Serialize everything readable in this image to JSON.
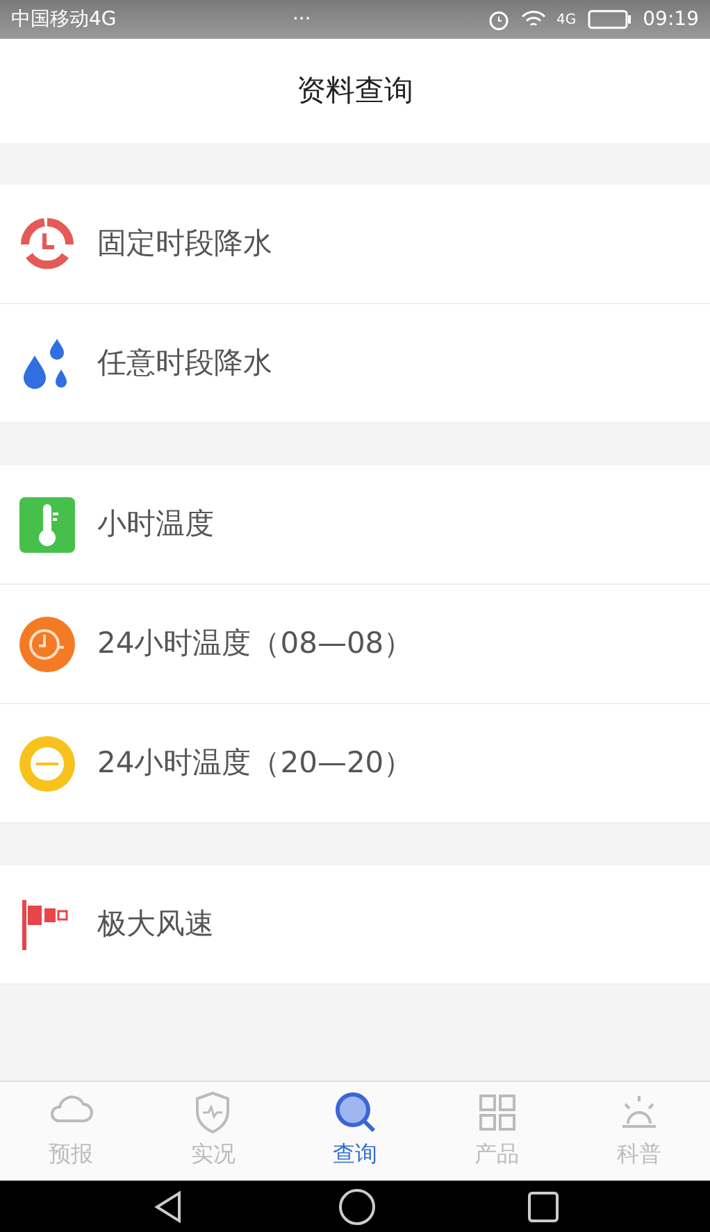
{
  "status_bar": {
    "carrier": "中国移动4G",
    "more": "···",
    "network": "4G",
    "time": "09:19"
  },
  "header": {
    "title": "资料查询"
  },
  "sections": [
    {
      "items": [
        {
          "label": "固定时段降水",
          "kind": "clock"
        },
        {
          "label": "任意时段降水",
          "kind": "drops"
        }
      ]
    },
    {
      "items": [
        {
          "label": "小时温度",
          "kind": "thermometer"
        },
        {
          "label": "24小时温度（08—08）",
          "kind": "dial"
        },
        {
          "label": "24小时温度（20—20）",
          "kind": "badge"
        }
      ]
    },
    {
      "items": [
        {
          "label": "极大风速",
          "kind": "windsock"
        }
      ]
    }
  ],
  "tabs": [
    {
      "label": "预报",
      "kind": "cloud",
      "selected": false
    },
    {
      "label": "实况",
      "kind": "shield",
      "selected": false
    },
    {
      "label": "查询",
      "kind": "search",
      "selected": true
    },
    {
      "label": "产品",
      "kind": "grid",
      "selected": false
    },
    {
      "label": "科普",
      "kind": "sun",
      "selected": false
    }
  ]
}
